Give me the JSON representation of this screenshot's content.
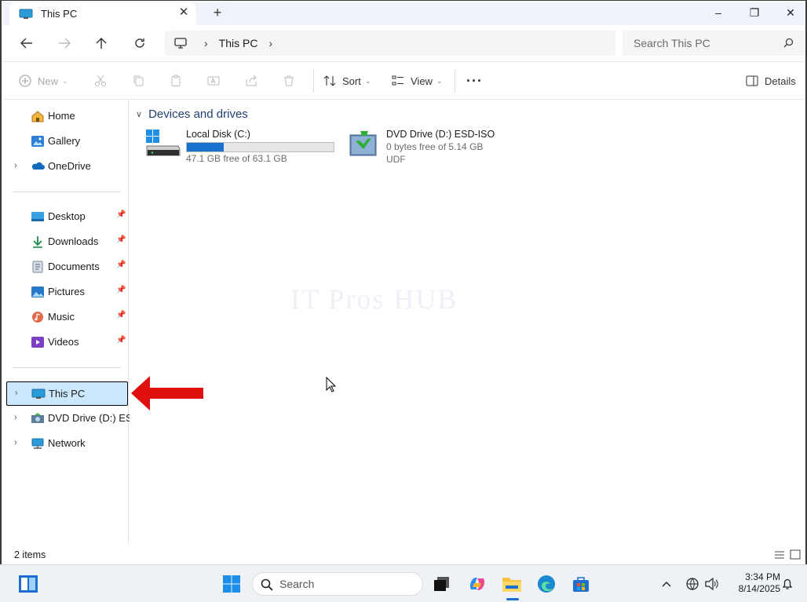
{
  "window": {
    "tab_title": "This PC",
    "controls": {
      "minimize": "–",
      "restore": "❐",
      "close": "✕"
    }
  },
  "address": {
    "crumbs": [
      "This PC"
    ],
    "search_placeholder": "Search This PC"
  },
  "commandbar": {
    "new_label": "New",
    "sort_label": "Sort",
    "view_label": "View",
    "more_label": "···",
    "details_label": "Details"
  },
  "sidebar": {
    "quick": [
      {
        "label": "Home",
        "icon": "home-icon",
        "expander": false
      },
      {
        "label": "Gallery",
        "icon": "gallery-icon",
        "expander": false
      },
      {
        "label": "OneDrive",
        "icon": "onedrive-icon",
        "expander": true
      }
    ],
    "pinned": [
      {
        "label": "Desktop",
        "icon": "desktop-folder-icon"
      },
      {
        "label": "Downloads",
        "icon": "downloads-icon"
      },
      {
        "label": "Documents",
        "icon": "documents-icon"
      },
      {
        "label": "Pictures",
        "icon": "pictures-icon"
      },
      {
        "label": "Music",
        "icon": "music-icon"
      },
      {
        "label": "Videos",
        "icon": "videos-icon"
      }
    ],
    "locations": [
      {
        "label": "This PC",
        "icon": "this-pc-icon",
        "selected": true
      },
      {
        "label": "DVD Drive (D:) ESD-",
        "icon": "dvd-drive-icon",
        "selected": false
      },
      {
        "label": "Network",
        "icon": "network-icon",
        "selected": false
      }
    ]
  },
  "content": {
    "group_title": "Devices and drives",
    "drives": [
      {
        "name": "Local Disk (C:)",
        "free_text": "47.1 GB free of 63.1 GB",
        "used_fraction": 0.254,
        "icon": "windows-drive-icon"
      },
      {
        "name": "DVD Drive (D:) ESD-ISO",
        "free_text": "0 bytes free of 5.14 GB",
        "fs": "UDF",
        "icon": "dvd-install-icon"
      }
    ],
    "watermark": "IT Pros HUB"
  },
  "status": {
    "item_count": "2 items"
  },
  "taskbar": {
    "search_placeholder": "Search",
    "time": "3:34 PM",
    "date": "8/14/2025"
  },
  "colors": {
    "accent": "#1a73cf",
    "selected": "#cce8ff",
    "arrow": "#e01010"
  }
}
